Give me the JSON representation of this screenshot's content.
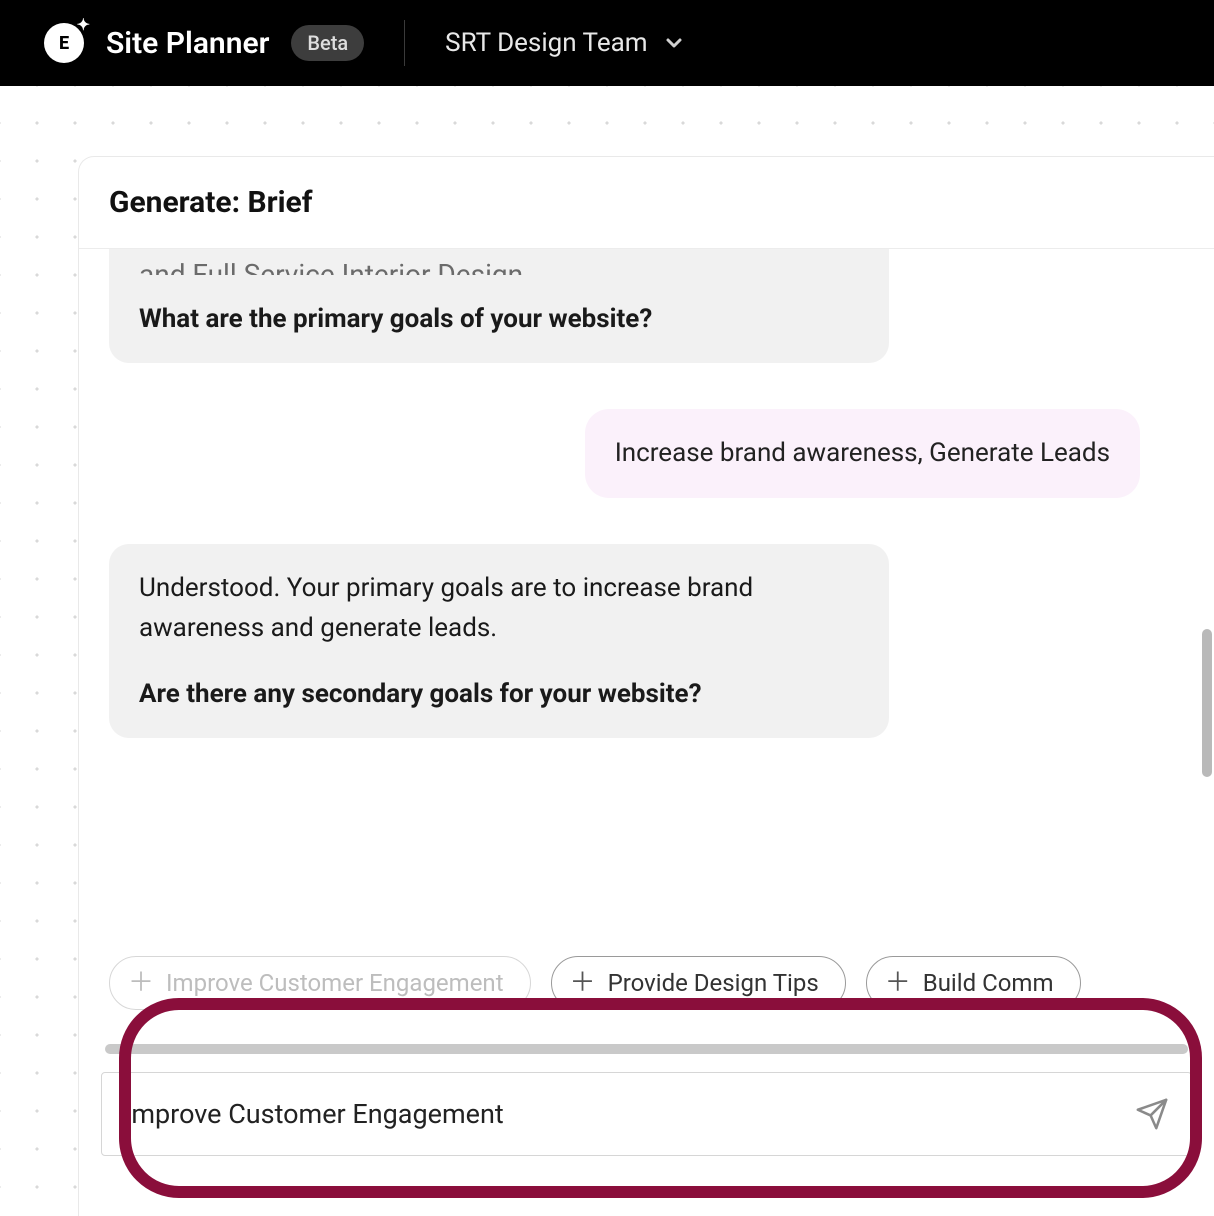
{
  "header": {
    "app_title": "Site Planner",
    "beta_label": "Beta",
    "team_name": "SRT Design Team",
    "logo_letter": "E"
  },
  "panel": {
    "title": "Generate: Brief"
  },
  "chat": {
    "msg0_clip": "and Full Service Interior Design.",
    "msg0_q": "What are the primary goals of your website?",
    "msg1_user": "Increase brand awareness, Generate Leads",
    "msg2_p1": "Understood. Your primary goals are to increase brand awareness and generate leads.",
    "msg2_q": "Are there any secondary goals for your website?"
  },
  "chips": {
    "c0": "Improve Customer Engagement",
    "c1": "Provide Design Tips",
    "c2": "Build Comm"
  },
  "input": {
    "value": "Improve Customer Engagement"
  }
}
